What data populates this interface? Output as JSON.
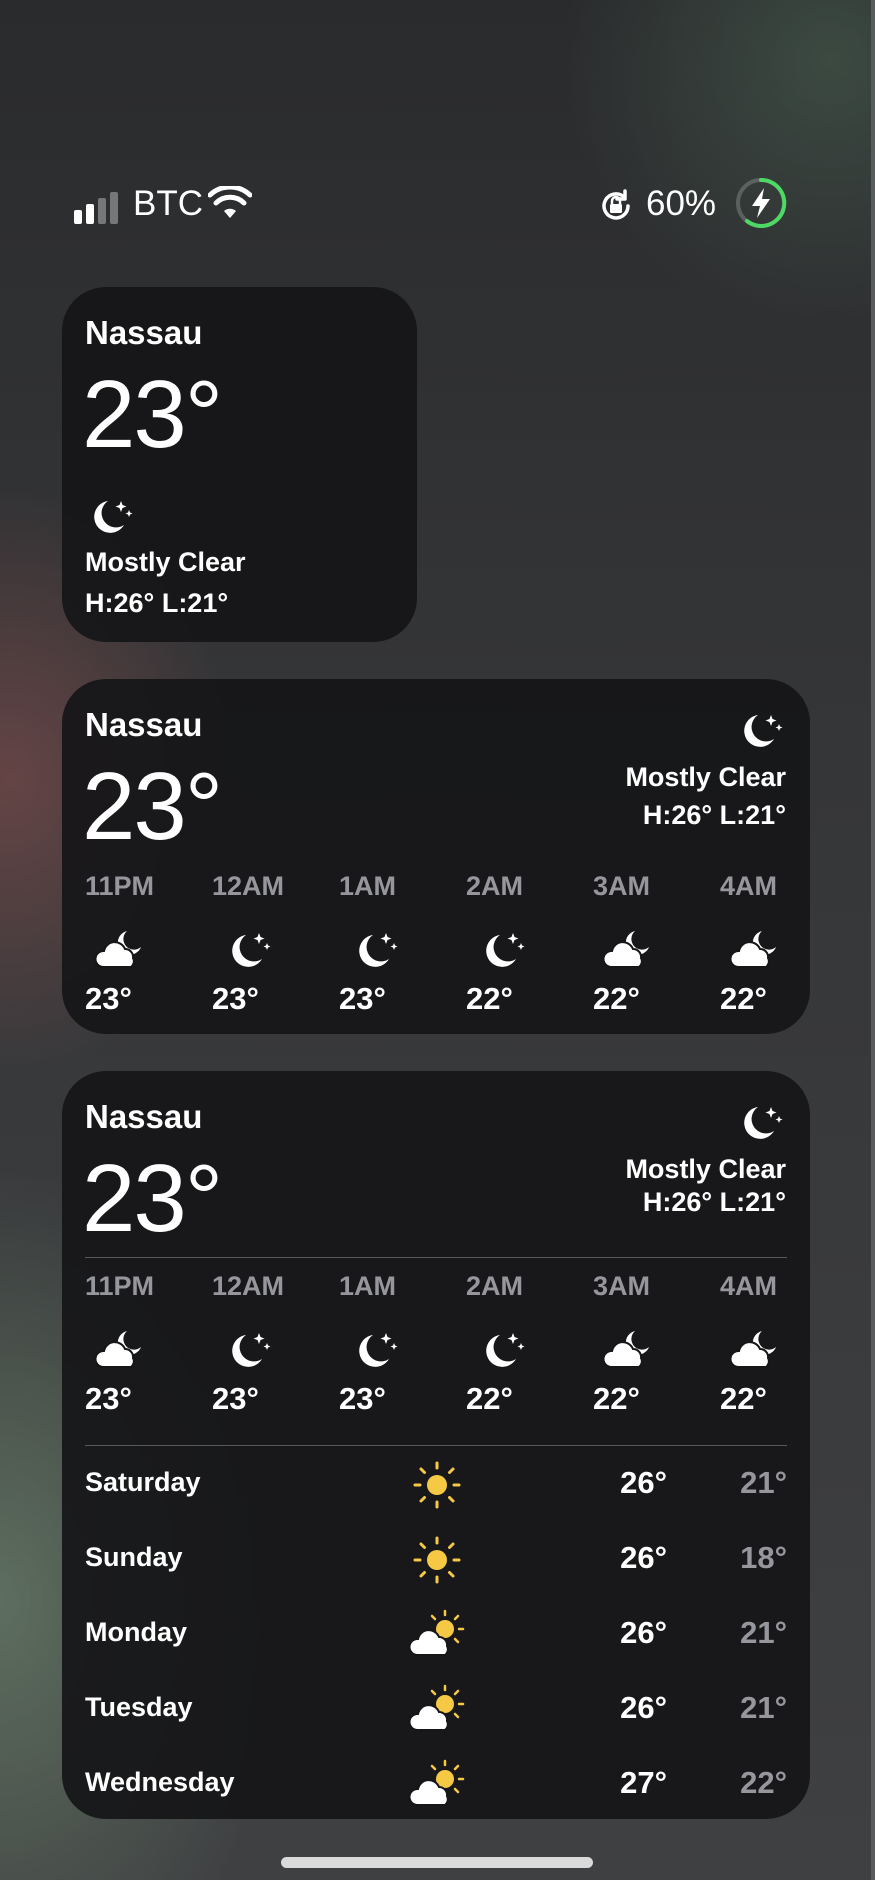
{
  "status_bar": {
    "carrier": "BTC",
    "battery_percent": "60%",
    "signal_bars": 2,
    "charging": true
  },
  "widgets": {
    "small": {
      "city": "Nassau",
      "temp": "23°",
      "condition": "Mostly Clear",
      "high_low": "H:26° L:21°",
      "icon": "moon-stars-icon"
    },
    "medium": {
      "city": "Nassau",
      "temp": "23°",
      "condition": "Mostly Clear",
      "high_low": "H:26° L:21°",
      "icon": "moon-stars-icon",
      "hourly": [
        {
          "time": "11PM",
          "icon": "cloud-moon-icon",
          "temp": "23°"
        },
        {
          "time": "12AM",
          "icon": "moon-stars-icon",
          "temp": "23°"
        },
        {
          "time": "1AM",
          "icon": "moon-stars-icon",
          "temp": "23°"
        },
        {
          "time": "2AM",
          "icon": "moon-stars-icon",
          "temp": "22°"
        },
        {
          "time": "3AM",
          "icon": "cloud-moon-icon",
          "temp": "22°"
        },
        {
          "time": "4AM",
          "icon": "cloud-moon-icon",
          "temp": "22°"
        }
      ]
    },
    "large": {
      "city": "Nassau",
      "temp": "23°",
      "condition": "Mostly Clear",
      "high_low": "H:26° L:21°",
      "icon": "moon-stars-icon",
      "hourly": [
        {
          "time": "11PM",
          "icon": "cloud-moon-icon",
          "temp": "23°"
        },
        {
          "time": "12AM",
          "icon": "moon-stars-icon",
          "temp": "23°"
        },
        {
          "time": "1AM",
          "icon": "moon-stars-icon",
          "temp": "23°"
        },
        {
          "time": "2AM",
          "icon": "moon-stars-icon",
          "temp": "22°"
        },
        {
          "time": "3AM",
          "icon": "cloud-moon-icon",
          "temp": "22°"
        },
        {
          "time": "4AM",
          "icon": "cloud-moon-icon",
          "temp": "22°"
        }
      ],
      "daily": [
        {
          "day": "Saturday",
          "icon": "sun-icon",
          "high": "26°",
          "low": "21°"
        },
        {
          "day": "Sunday",
          "icon": "sun-icon",
          "high": "26°",
          "low": "18°"
        },
        {
          "day": "Monday",
          "icon": "cloud-sun-icon",
          "high": "26°",
          "low": "21°"
        },
        {
          "day": "Tuesday",
          "icon": "cloud-sun-icon",
          "high": "26°",
          "low": "21°"
        },
        {
          "day": "Wednesday",
          "icon": "cloud-sun-icon",
          "high": "27°",
          "low": "22°"
        }
      ]
    }
  },
  "colors": {
    "sun": "#F6C945",
    "battery_ring": "#4CD964",
    "widget_bg": "#161618"
  }
}
